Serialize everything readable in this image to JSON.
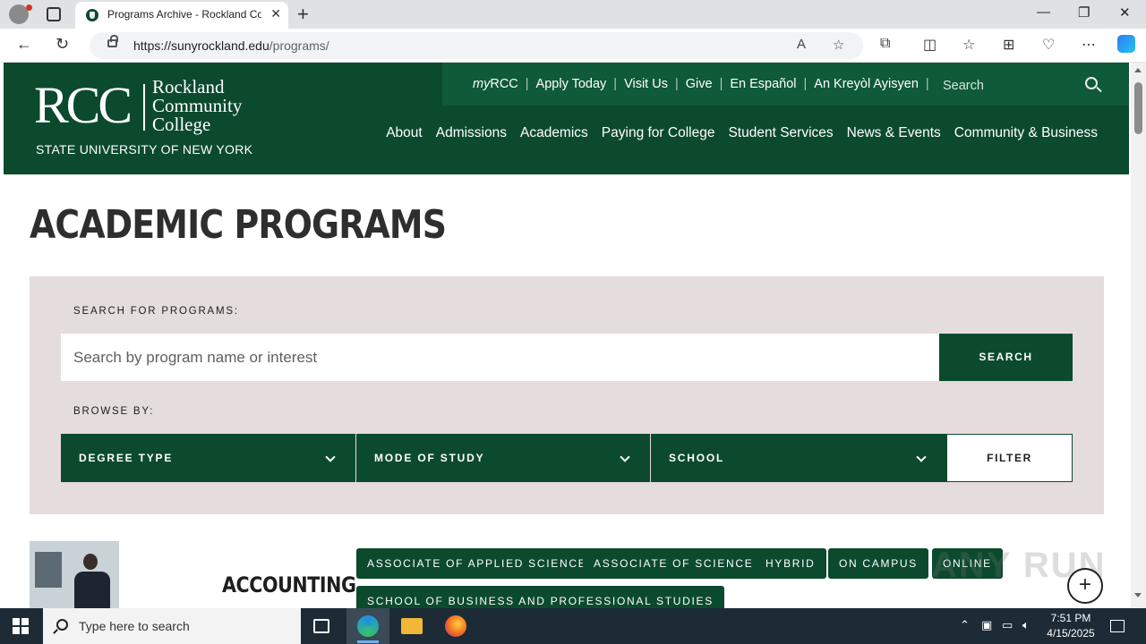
{
  "browser": {
    "tab_title": "Programs Archive - Rockland Co",
    "url_host": "https://sunyrockland.edu",
    "url_path": "/programs/"
  },
  "site": {
    "logo_rcc": "RCC",
    "logo_name_1": "Rockland",
    "logo_name_2": "Community",
    "logo_name_3": "College",
    "logo_suny": "STATE UNIVERSITY OF NEW YORK",
    "utility_links": {
      "my_prefix": "my",
      "my_suffix": "RCC",
      "apply": "Apply Today",
      "visit": "Visit Us",
      "give": "Give",
      "espanol": "En Español",
      "kreyol": "An Kreyòl Ayisyen"
    },
    "utility_search_placeholder": "Search",
    "nav": [
      "About",
      "Admissions",
      "Academics",
      "Paying for College",
      "Student Services",
      "News & Events",
      "Community & Business"
    ]
  },
  "page": {
    "title": "ACADEMIC PROGRAMS",
    "search_label": "SEARCH FOR PROGRAMS:",
    "search_placeholder": "Search by program name or interest",
    "search_button": "SEARCH",
    "browse_label": "BROWSE BY:",
    "filters": [
      "DEGREE TYPE",
      "MODE OF STUDY",
      "SCHOOL"
    ],
    "filter_button": "FILTER"
  },
  "program": {
    "name": "ACCOUNTING",
    "tags": [
      "ASSOCIATE OF APPLIED SCIENCE",
      "ASSOCIATE OF SCIENCE",
      "HYBRID",
      "ON CAMPUS",
      "ONLINE"
    ],
    "school_tag": "SCHOOL OF BUSINESS AND PROFESSIONAL STUDIES"
  },
  "watermark": "ANY RUN",
  "taskbar": {
    "search_placeholder": "Type here to search",
    "time": "7:51 PM",
    "date": "4/15/2025"
  },
  "colors": {
    "brand_green": "#0c4a2e",
    "panel_bg": "#e5dcdc"
  }
}
